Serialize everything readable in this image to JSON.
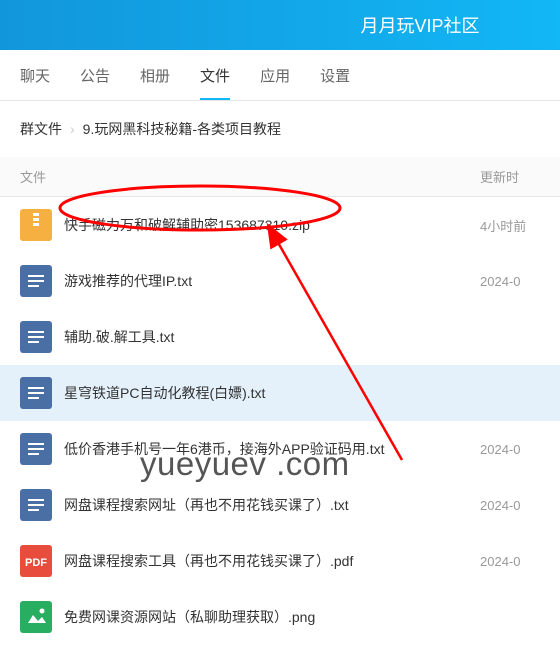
{
  "header": {
    "title": "月月玩VIP社区"
  },
  "tabs": [
    {
      "label": "聊天"
    },
    {
      "label": "公告"
    },
    {
      "label": "相册"
    },
    {
      "label": "文件",
      "active": true
    },
    {
      "label": "应用"
    },
    {
      "label": "设置"
    }
  ],
  "breadcrumb": {
    "root": "群文件",
    "path": "9.玩网黑科技秘籍-各类项目教程"
  },
  "columns": {
    "name": "文件",
    "time": "更新时"
  },
  "files": [
    {
      "name": "快手磁力万和破解辅助密153687310.zip",
      "time": "4小时前",
      "type": "zip"
    },
    {
      "name": "游戏推荐的代理IP.txt",
      "time": "2024-0",
      "type": "txt"
    },
    {
      "name": "辅助.破.解工具.txt",
      "time": "",
      "type": "txt"
    },
    {
      "name": "星穹铁道PC自动化教程(白嫖).txt",
      "time": "",
      "type": "txt",
      "highlighted": true
    },
    {
      "name": "低价香港手机号一年6港币，接海外APP验证码用.txt",
      "time": "2024-0",
      "type": "txt"
    },
    {
      "name": "网盘课程搜索网址（再也不用花钱买课了）.txt",
      "time": "2024-0",
      "type": "txt"
    },
    {
      "name": "网盘课程搜索工具（再也不用花钱买课了）.pdf",
      "time": "2024-0",
      "type": "pdf"
    },
    {
      "name": "免费网课资源网站（私聊助理获取）.png",
      "time": "",
      "type": "png"
    }
  ],
  "watermark": "yueyuev .com"
}
